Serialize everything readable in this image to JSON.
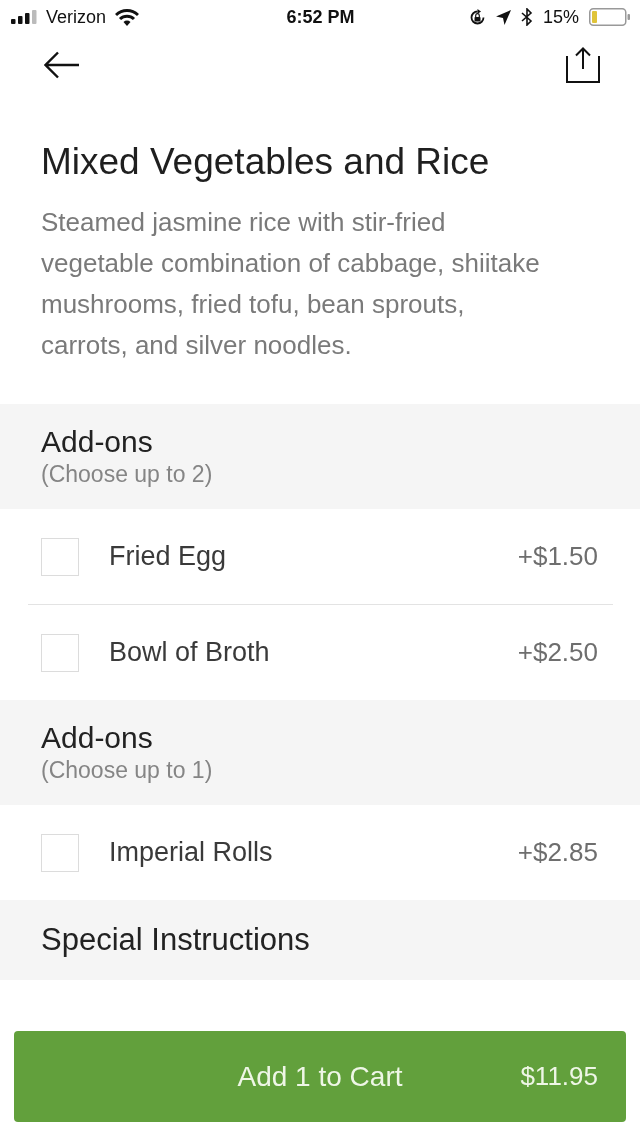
{
  "status_bar": {
    "carrier": "Verizon",
    "time": "6:52 PM",
    "battery_percent": "15%"
  },
  "item": {
    "title": "Mixed Vegetables and Rice",
    "description": "Steamed jasmine rice with stir-fried vegetable combination of cabbage, shiitake mushrooms, fried tofu, bean sprouts, carrots, and silver noodles."
  },
  "option_groups": [
    {
      "title": "Add-ons",
      "hint": "(Choose up to 2)",
      "options": [
        {
          "name": "Fried Egg",
          "price": "+$1.50",
          "checked": false
        },
        {
          "name": "Bowl of Broth",
          "price": "+$2.50",
          "checked": false
        }
      ]
    },
    {
      "title": "Add-ons",
      "hint": "(Choose up to 1)",
      "options": [
        {
          "name": "Imperial Rolls",
          "price": "+$2.85",
          "checked": false
        }
      ]
    }
  ],
  "special_instructions": {
    "title": "Special Instructions"
  },
  "cart_button": {
    "label": "Add 1 to Cart",
    "price": "$11.95"
  }
}
